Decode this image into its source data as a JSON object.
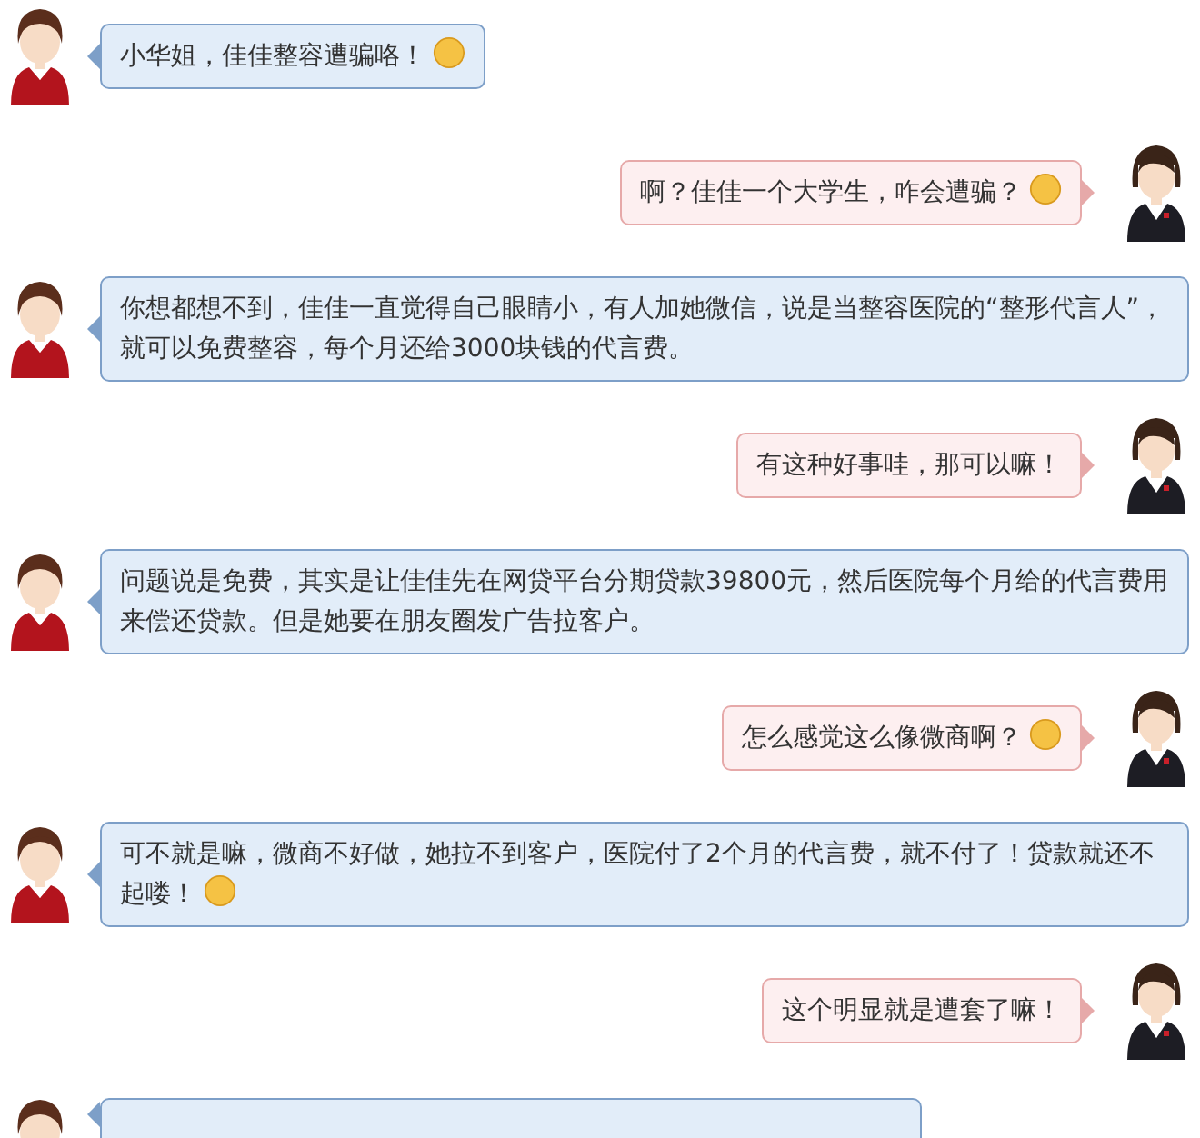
{
  "messages": [
    {
      "kind": "message",
      "outgoing": false,
      "text": "小华姐，佳佳整容遭骗咯！",
      "emoji": true
    },
    {
      "kind": "message",
      "outgoing": true,
      "text": "啊？佳佳一个大学生，咋会遭骗？",
      "emoji": true
    },
    {
      "kind": "message",
      "outgoing": false,
      "text": "你想都想不到，佳佳一直觉得自己眼睛小，有人加她微信，说是当整容医院的“整形代言人”，就可以免费整容，每个月还给3000块钱的代言费。",
      "emoji": false
    },
    {
      "kind": "message",
      "outgoing": true,
      "text": "有这种好事哇，那可以嘛！",
      "emoji": false
    },
    {
      "kind": "message",
      "outgoing": false,
      "text": "问题说是免费，其实是让佳佳先在网贷平台分期贷款39800元，然后医院每个月给的代言费用来偿还贷款。但是她要在朋友圈发广告拉客户。",
      "emoji": false
    },
    {
      "kind": "message",
      "outgoing": true,
      "text": "怎么感觉这么像微商啊？",
      "emoji": true
    },
    {
      "kind": "message",
      "outgoing": false,
      "text": "可不就是嘛，微商不好做，她拉不到客户，医院付了2个月的代言费，就不付了！贷款就还不起喽！",
      "emoji": true
    },
    {
      "kind": "message",
      "outgoing": true,
      "text": "这个明显就是遭套了嘛！",
      "emoji": false
    },
    {
      "kind": "cut",
      "outgoing": false
    }
  ]
}
